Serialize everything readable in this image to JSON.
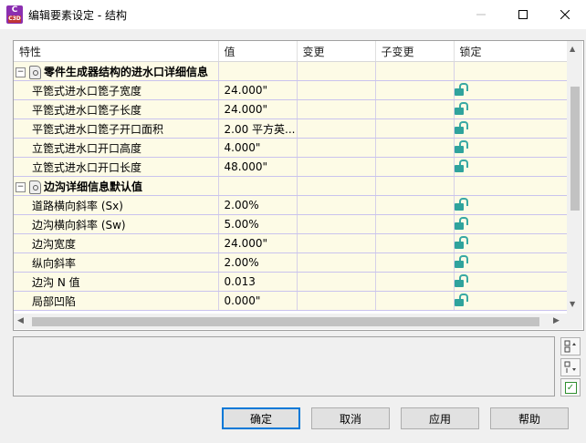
{
  "window": {
    "title": "编辑要素设定 - 结构",
    "app_icon_letter": "C",
    "app_icon_sub": "C3D"
  },
  "grid": {
    "columns": [
      "特性",
      "值",
      "变更",
      "子变更",
      "锁定"
    ],
    "categories": [
      {
        "title": "零件生成器结构的进水口详细信息",
        "expander": "⊟",
        "rows": [
          {
            "name": "平箆式进水口箆子宽度",
            "value": "24.000\""
          },
          {
            "name": "平箆式进水口箆子长度",
            "value": "24.000\""
          },
          {
            "name": "平箆式进水口箆子开口面积",
            "value": "2.00 平方英..."
          },
          {
            "name": "立箆式进水口开口高度",
            "value": "4.000\""
          },
          {
            "name": "立箆式进水口开口长度",
            "value": "48.000\""
          }
        ]
      },
      {
        "title": "边沟详细信息默认值",
        "expander": "⊟",
        "rows": [
          {
            "name": "道路横向斜率 (Sx)",
            "value": "2.00%"
          },
          {
            "name": "边沟横向斜率 (Sw)",
            "value": "5.00%"
          },
          {
            "name": "边沟宽度",
            "value": "24.000\""
          },
          {
            "name": "纵向斜率",
            "value": "2.00%"
          },
          {
            "name": "边沟 N 值",
            "value": "0.013"
          },
          {
            "name": "局部凹陷",
            "value": "0.000\""
          }
        ]
      }
    ]
  },
  "side_buttons": [
    "categorized-icon",
    "alphabetic-icon",
    "check-icon"
  ],
  "buttons": {
    "ok": "确定",
    "cancel": "取消",
    "apply": "应用",
    "help": "帮助"
  },
  "colors": {
    "row_background": "#fdfbe6",
    "lock_icon": "#2fa39c",
    "primary_border": "#0078d7"
  }
}
